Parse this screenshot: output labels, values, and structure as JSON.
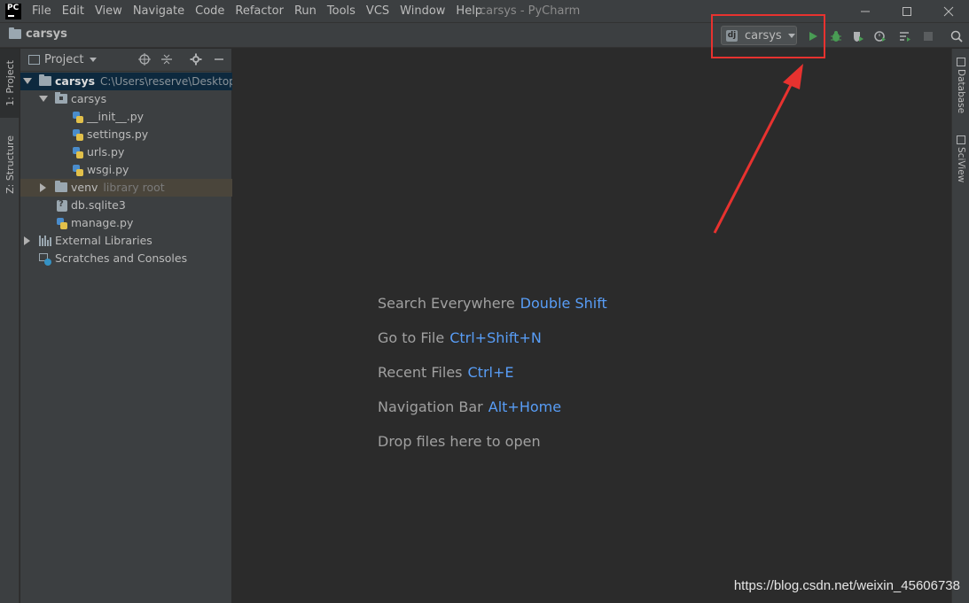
{
  "app": {
    "logo_text": "PC",
    "window_title": "carsys - PyCharm"
  },
  "menu": [
    "File",
    "Edit",
    "View",
    "Navigate",
    "Code",
    "Refactor",
    "Run",
    "Tools",
    "VCS",
    "Window",
    "Help"
  ],
  "window_controls": [
    "minimize-icon",
    "maximize-icon",
    "close-icon"
  ],
  "navbar": {
    "breadcrumb": "carsys",
    "run_config": {
      "icon_letter": "dj",
      "label": "carsys"
    },
    "toolbar_icons": [
      "run-icon",
      "debug-icon",
      "coverage-icon",
      "profile-icon",
      "run-with-concurrency-icon",
      "stop-icon",
      "search-icon"
    ],
    "highlight_color": "#e8322f"
  },
  "left_tabs": {
    "project": "1: Project",
    "structure": "Z: Structure"
  },
  "project_panel": {
    "header_label": "Project",
    "header_tools": [
      "locate-icon",
      "collapse-all-icon",
      "settings-gear-icon",
      "hide-icon"
    ],
    "tree": {
      "root_label": "carsys",
      "root_path": "C:\\Users\\reserve\\Desktop\\",
      "pkg_label": "carsys",
      "files": [
        "__init__.py",
        "settings.py",
        "urls.py",
        "wsgi.py"
      ],
      "venv_label": "venv",
      "venv_note": "library root",
      "db_file": "db.sqlite3",
      "manage_file": "manage.py",
      "external_libraries": "External Libraries",
      "scratches": "Scratches and Consoles"
    }
  },
  "editor": {
    "hints": [
      {
        "text": "Search Everywhere",
        "key": "Double Shift"
      },
      {
        "text": "Go to File",
        "key": "Ctrl+Shift+N"
      },
      {
        "text": "Recent Files",
        "key": "Ctrl+E"
      },
      {
        "text": "Navigation Bar",
        "key": "Alt+Home"
      },
      {
        "text": "Drop files here to open",
        "key": ""
      }
    ],
    "key_color": "#589df6"
  },
  "right_tabs": {
    "database": "Database",
    "sciview": "SciView"
  },
  "watermark": "https://blog.csdn.net/weixin_45606738"
}
